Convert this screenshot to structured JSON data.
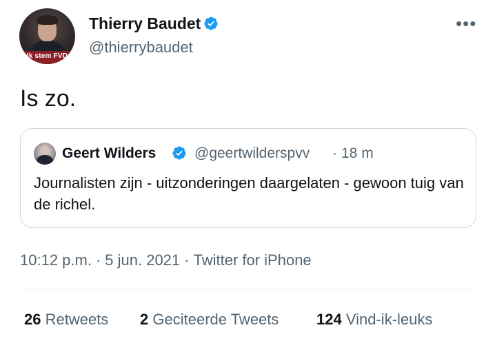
{
  "author": {
    "name": "Thierry Baudet",
    "handle": "@thierrybaudet",
    "avatar_badge": "Ik stem FVD",
    "verified_icon": "verified-badge-icon"
  },
  "tweet": {
    "text": "Is zo."
  },
  "quoted_tweet": {
    "name": "Geert Wilders",
    "handle": "@geertwilderspvv",
    "separator": "·",
    "time": "18 m",
    "text": "Journalisten zijn - uitzonderingen daargelaten - gewoon tuig van de richel."
  },
  "meta": {
    "time": "10:12 p.m.",
    "date": "5 jun. 2021",
    "source": "Twitter for iPhone",
    "separator": "·"
  },
  "stats": {
    "retweets_count": "26",
    "retweets_label": "Retweets",
    "quotes_count": "2",
    "quotes_label": "Geciteerde Tweets",
    "likes_count": "124",
    "likes_label": "Vind-ik-leuks"
  },
  "colors": {
    "verified": "#1d9bf0",
    "secondary_text": "#536471",
    "primary_text": "#0f1419",
    "border": "#cfd9de",
    "avatar_banner": "#8b1f27"
  }
}
